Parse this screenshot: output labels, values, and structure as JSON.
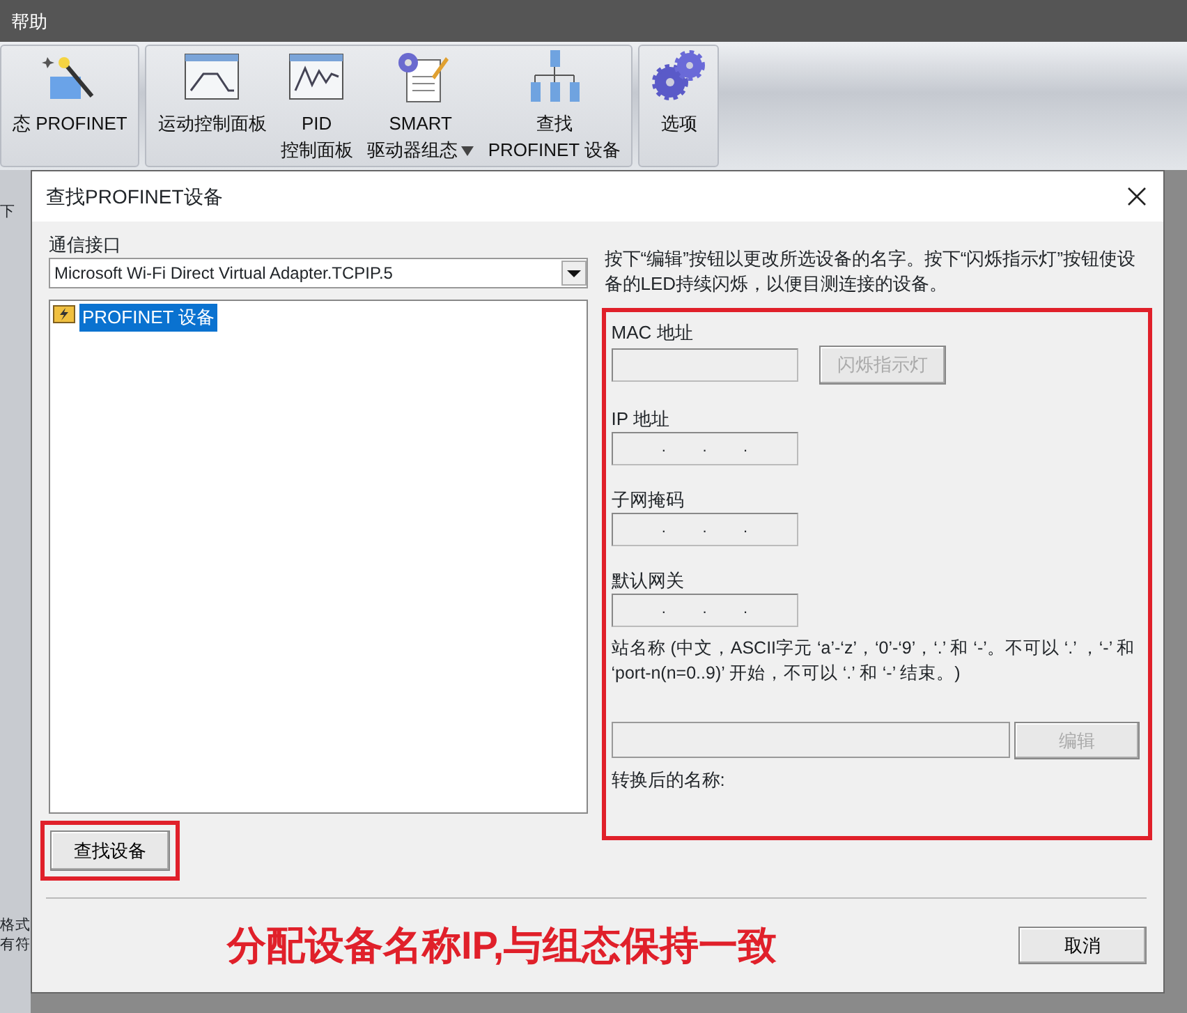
{
  "menu": {
    "label": "帮助"
  },
  "ribbon_groups": [
    {
      "items": [
        {
          "kind": "wizard",
          "lines": [
            "态 PROFINET"
          ],
          "dropdown": false
        }
      ]
    },
    {
      "items": [
        {
          "kind": "motion",
          "lines": [
            "运动控制面板"
          ],
          "dropdown": false
        },
        {
          "kind": "pid",
          "lines": [
            "PID",
            "控制面板"
          ],
          "dropdown": false
        },
        {
          "kind": "smart",
          "lines": [
            "SMART",
            "驱动器组态"
          ],
          "dropdown": true
        },
        {
          "kind": "network",
          "lines": [
            "查找",
            "PROFINET 设备"
          ],
          "dropdown": false
        }
      ]
    },
    {
      "items": [
        {
          "kind": "gears",
          "lines": [
            "选项"
          ],
          "dropdown": false
        }
      ]
    }
  ],
  "background_labels": [
    "下",
    "格式",
    "有符"
  ],
  "dialog": {
    "title": "查找PROFINET设备",
    "interface_label": "通信接口",
    "interface_value": "Microsoft Wi-Fi Direct Virtual Adapter.TCPIP.5",
    "tree": [
      {
        "label": "PROFINET 设备",
        "selected": true
      }
    ],
    "find_button": "查找设备",
    "instructions": "按下“编辑”按钮以更改所选设备的名字。按下“闪烁指示灯”按钮使设备的LED持续闪烁，以便目测连接的设备。",
    "fields": [
      {
        "kind": "mac",
        "label": "MAC 地址"
      },
      {
        "kind": "ip",
        "label": "IP 地址",
        "separator": "."
      },
      {
        "kind": "ip",
        "label": "子网掩码",
        "separator": "."
      },
      {
        "kind": "ip",
        "label": "默认网关",
        "separator": "."
      }
    ],
    "flash_button": {
      "label": "闪烁指示灯",
      "disabled": true
    },
    "station_label": "站名称 (中文，ASCII字元 ‘a’-‘z’，‘0’-‘9’，‘.’ 和 ‘-’。不可以 ‘.’ ，‘-’ 和 ‘port-n(n=0..9)’ 开始，不可以 ‘.’ 和 ‘-’ 结束。)",
    "edit_button": {
      "label": "编辑",
      "disabled": true
    },
    "converted_label": "转换后的名称:",
    "cancel_button": "取消",
    "annotation": "分配设备名称IP,与组态保持一致"
  }
}
